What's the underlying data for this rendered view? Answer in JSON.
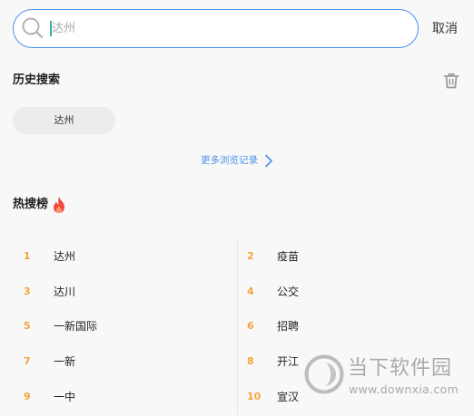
{
  "search": {
    "placeholder": "达州",
    "cancel_label": "取消"
  },
  "history": {
    "title": "历史搜索",
    "items": [
      {
        "label": "达州"
      }
    ],
    "more_label": "更多浏览记录"
  },
  "hot": {
    "title": "热搜榜",
    "items": [
      {
        "rank": "1",
        "label": "达州"
      },
      {
        "rank": "2",
        "label": "疫苗"
      },
      {
        "rank": "3",
        "label": "达川"
      },
      {
        "rank": "4",
        "label": "公交"
      },
      {
        "rank": "5",
        "label": "一新国际"
      },
      {
        "rank": "6",
        "label": "招聘"
      },
      {
        "rank": "7",
        "label": "一新"
      },
      {
        "rank": "8",
        "label": "开江"
      },
      {
        "rank": "9",
        "label": "一中"
      },
      {
        "rank": "10",
        "label": "宣汉"
      }
    ]
  },
  "icons": {
    "search": "search-icon",
    "clear_history": "trash-icon",
    "more": "chevron-right-icon",
    "hot": "fire-icon",
    "watermark_logo": "downxia-logo-icon"
  },
  "colors": {
    "accent": "#4d93ea",
    "rank": "#f4a33c",
    "flame": "#f14b3c",
    "background": "#f8f8f8"
  },
  "watermark": {
    "brand": "当下软件园",
    "url": "www.downxia.com"
  }
}
